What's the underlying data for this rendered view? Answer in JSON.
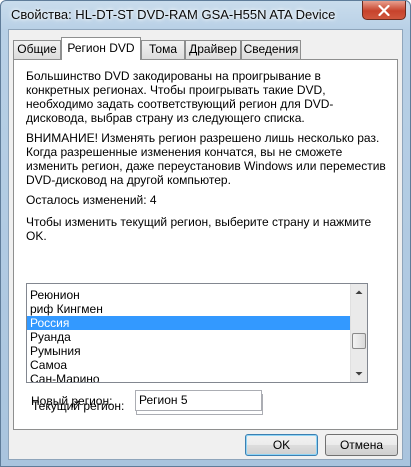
{
  "window": {
    "title": "Свойства: HL-DT-ST DVD-RAM GSA-H55N ATA Device"
  },
  "icons": {
    "close": "close-x-icon",
    "scroll_up": "chevron-up-icon",
    "scroll_down": "chevron-down-icon"
  },
  "tabs": [
    {
      "label": "Общие"
    },
    {
      "label": "Регион DVD"
    },
    {
      "label": "Тома"
    },
    {
      "label": "Драйвер"
    },
    {
      "label": "Сведения"
    }
  ],
  "region_tab": {
    "intro": "Большинство DVD закодированы на проигрывание в конкретных регионах. Чтобы проигрывать такие DVD, необходимо задать соответствующий регион для DVD-дисковода, выбрав страну из следующего списка.",
    "warning": "ВНИМАНИЕ! Изменять регион разрешено лишь несколько раз. Когда разрешенные изменения кончатся, вы не сможете изменить регион, даже переустановив Windows или переместив DVD-дисковод на другой компьютер.",
    "changes_left": "Осталось изменений: 4",
    "instruction": "Чтобы изменить текущий регион, выберите страну и нажмите OK.",
    "countries": [
      {
        "label": "Реюнион"
      },
      {
        "label": "риф Кингмен"
      },
      {
        "label": "Россия"
      },
      {
        "label": "Руанда"
      },
      {
        "label": "Румыния"
      },
      {
        "label": "Самоа"
      },
      {
        "label": "Сан-Марино"
      }
    ],
    "selected_index": 2,
    "current_region_label": "Текущий регион:",
    "current_region_value": "Регион 5",
    "new_region_label": "Новый регион:",
    "new_region_value": "Регион 5"
  },
  "buttons": {
    "ok": "OK",
    "cancel": "Отмена"
  }
}
